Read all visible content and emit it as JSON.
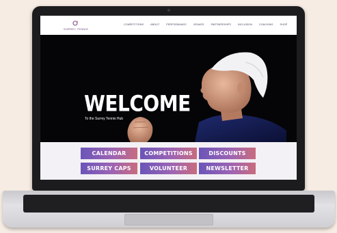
{
  "site": {
    "logo_text": "SURREY TENNIS",
    "nav": [
      "COMPETITIONS",
      "ABOUT",
      "PERFORMANCE",
      "VENUES",
      "PARTNERSHIPS",
      "INCLUSION",
      "COACHING",
      "SHOP"
    ]
  },
  "hero": {
    "title": "WELCOME",
    "subtitle": "To the Surrey Tennis Hub"
  },
  "buttons": [
    "CALENDAR",
    "COMPETITIONS",
    "DISCOUNTS",
    "SURREY CAPS",
    "VOLUNTEER",
    "NEWSLETTER"
  ],
  "colors": {
    "button_gradient_start": "#6a55b8",
    "button_gradient_end": "#c86c7e",
    "hero_background": "#050507",
    "brand": "#6a3f7a"
  },
  "icons": {
    "logo": "surrey-tennis-logo-icon"
  }
}
